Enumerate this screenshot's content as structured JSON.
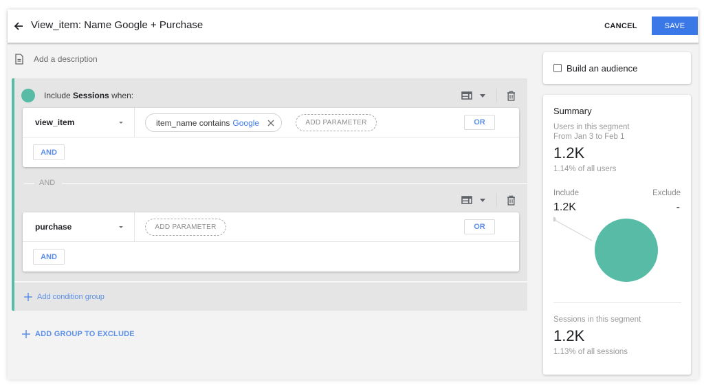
{
  "header": {
    "title": "View_item: Name Google + Purchase",
    "cancel_label": "CANCEL",
    "save_label": "SAVE"
  },
  "description": {
    "placeholder": "Add a description"
  },
  "include_group": {
    "prefix": "Include ",
    "scope": "Sessions",
    "suffix": " when:",
    "accent_color": "#57bba6",
    "conditions": [
      {
        "event": "view_item",
        "parameters": [
          {
            "name_op": "item_name contains",
            "value": "Google"
          }
        ],
        "add_parameter_label": "ADD PARAMETER",
        "or_label": "OR",
        "and_label": "AND"
      },
      {
        "event": "purchase",
        "parameters": [],
        "add_parameter_label": "ADD PARAMETER",
        "or_label": "OR",
        "and_label": "AND"
      }
    ],
    "and_divider_label": "AND",
    "add_condition_group_label": "Add condition group"
  },
  "add_group_to_exclude_label": "ADD GROUP TO EXCLUDE",
  "audience": {
    "label": "Build an audience",
    "checked": false
  },
  "summary": {
    "title": "Summary",
    "users_label": "Users in this segment",
    "date_range": "From Jan 3 to Feb 1",
    "users_value": "1.2K",
    "users_pct": "1.14% of all users",
    "include_label": "Include",
    "exclude_label": "Exclude",
    "include_value": "1.2K",
    "exclude_value": "-",
    "pie": {
      "include_share": 1.0,
      "include_color": "#57bba6"
    },
    "sessions_label": "Sessions in this segment",
    "sessions_value": "1.2K",
    "sessions_pct": "1.13% of all sessions"
  },
  "colors": {
    "primary": "#3b78e7",
    "link": "#5a8ee8",
    "accent": "#57bba6"
  }
}
